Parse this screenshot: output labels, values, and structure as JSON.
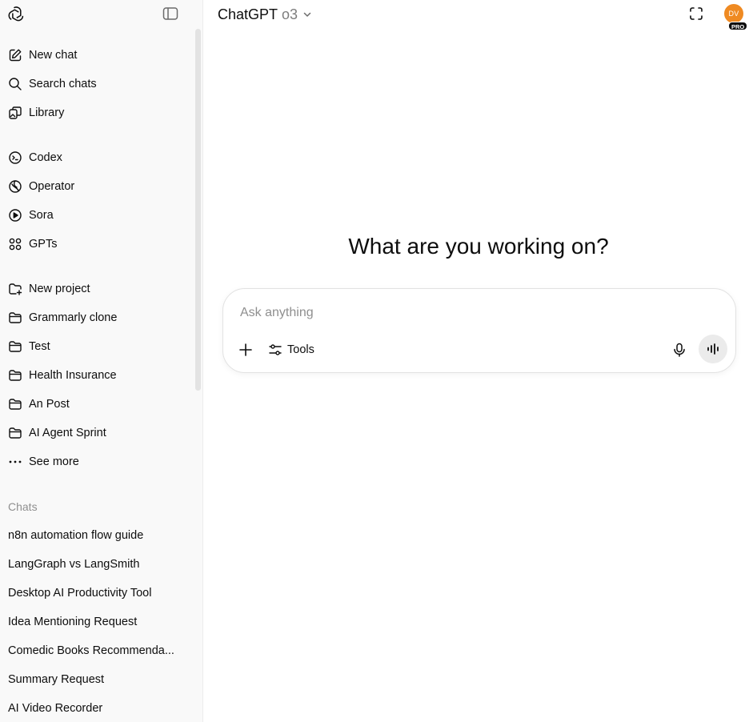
{
  "sidebar": {
    "primary": [
      {
        "label": "New chat",
        "icon": "edit-icon"
      },
      {
        "label": "Search chats",
        "icon": "search-icon"
      },
      {
        "label": "Library",
        "icon": "library-icon"
      }
    ],
    "tools": [
      {
        "label": "Codex",
        "icon": "codex-icon"
      },
      {
        "label": "Operator",
        "icon": "operator-icon"
      },
      {
        "label": "Sora",
        "icon": "play-icon"
      },
      {
        "label": "GPTs",
        "icon": "grid-icon"
      }
    ],
    "projects": [
      {
        "label": "New project",
        "icon": "folder-plus-icon"
      },
      {
        "label": "Grammarly clone",
        "icon": "folder-icon"
      },
      {
        "label": "Test",
        "icon": "folder-icon"
      },
      {
        "label": "Health Insurance",
        "icon": "folder-icon"
      },
      {
        "label": "An Post",
        "icon": "folder-icon"
      },
      {
        "label": "AI Agent Sprint",
        "icon": "folder-icon"
      },
      {
        "label": "See more",
        "icon": "more-icon"
      }
    ],
    "chats_label": "Chats",
    "chats": [
      "n8n automation flow guide",
      "LangGraph vs LangSmith",
      "Desktop AI Productivity Tool",
      "Idea Mentioning Request",
      "Comedic Books Recommenda...",
      "Summary Request",
      "AI Video Recorder"
    ]
  },
  "header": {
    "app_name": "ChatGPT",
    "model": "o3",
    "avatar_initials": "DV",
    "plan_badge": "PRO"
  },
  "main": {
    "heading": "What are you working on?",
    "composer": {
      "placeholder": "Ask anything",
      "tools_label": "Tools"
    }
  },
  "colors": {
    "avatar": "#ef8a22",
    "sidebar_bg": "#f9f9f9"
  }
}
